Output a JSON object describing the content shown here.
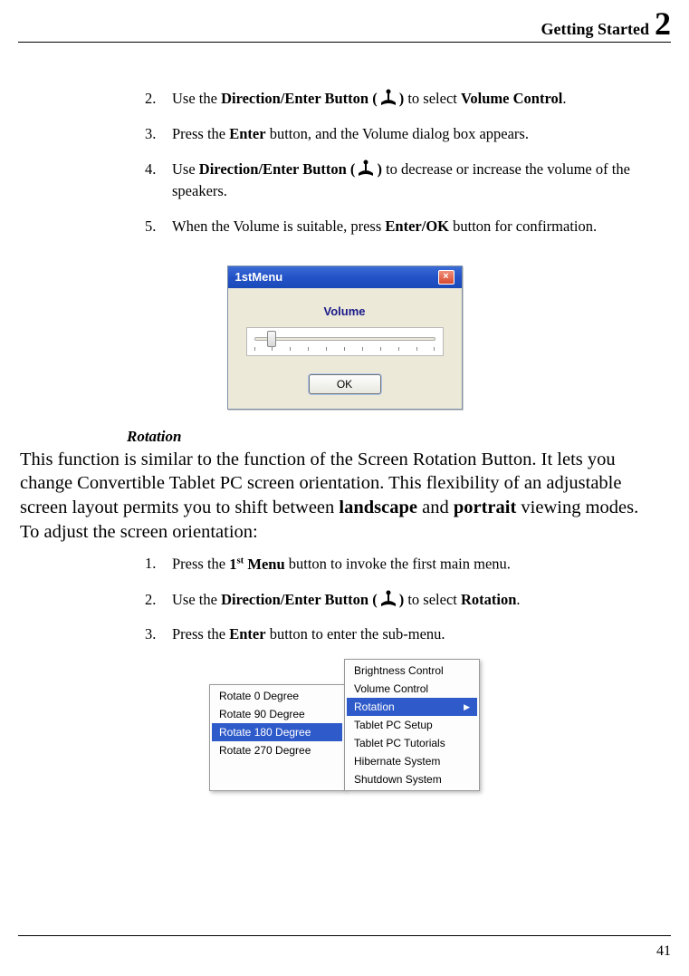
{
  "header": {
    "title": "Getting Started",
    "chapter": "2"
  },
  "listA": [
    {
      "n": "2.",
      "pre": "Use the ",
      "bold1": "Direction/Enter Button (",
      "icon": true,
      "bold2": ")",
      "mid": " to select ",
      "bold3": "Volume Control",
      "post": "."
    },
    {
      "n": "3.",
      "pre": "Press the ",
      "bold1": "Enter",
      "post": " button, and the Volume dialog box appears."
    },
    {
      "n": "4.",
      "pre": "Use ",
      "bold1": "Direction/Enter Button (",
      "icon": true,
      "bold2": ")",
      "post": " to decrease or increase the volume of the speakers."
    },
    {
      "n": "5.",
      "pre": "When the Volume is suitable, press ",
      "bold1": "Enter/OK",
      "post": " button for confirmation."
    }
  ],
  "dialog": {
    "titlebar": "1stMenu",
    "label": "Volume",
    "ok": "OK"
  },
  "subheading": "Rotation",
  "paragraph": {
    "t1": "This function is similar to the function of the Screen Rotation Button. It lets you change Convertible Tablet PC screen orientation. This flexibility of an adjustable screen layout permits you to shift between ",
    "b1": "landscape",
    "t2": " and ",
    "b2": "portrait",
    "t3": " viewing modes. To adjust the screen orientation:"
  },
  "listB": [
    {
      "n": "1.",
      "pre": "Press the ",
      "bold1": "1",
      "sup": "st",
      "bold2": " Menu",
      "post": " button to invoke the first main menu."
    },
    {
      "n": "2.",
      "pre": "Use the ",
      "bold1": "Direction/Enter Button (",
      "icon": true,
      "bold2": ")",
      "mid": " to select ",
      "bold3": "Rotation",
      "post": "."
    },
    {
      "n": "3.",
      "pre": "Press the ",
      "bold1": "Enter",
      "post": " button to enter the sub-menu."
    }
  ],
  "submenu_left": [
    "Rotate 0 Degree",
    "Rotate 90 Degree",
    "Rotate 180 Degree",
    "Rotate 270 Degree"
  ],
  "submenu_left_selected": 2,
  "submenu_right": [
    "Brightness Control",
    "Volume Control",
    "Rotation",
    "Tablet PC Setup",
    "Tablet PC Tutorials",
    "Hibernate System",
    "Shutdown System"
  ],
  "submenu_right_selected": 2,
  "page_number": "41"
}
